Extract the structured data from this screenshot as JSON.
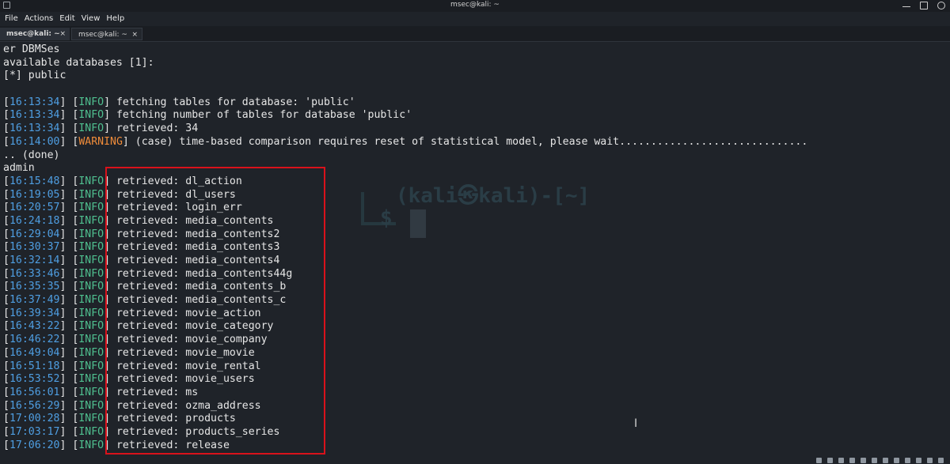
{
  "window": {
    "title": "msec@kali: ~"
  },
  "menu": [
    "File",
    "Actions",
    "Edit",
    "View",
    "Help"
  ],
  "tabs": [
    {
      "label": "msec@kali: ~",
      "active": true
    },
    {
      "label": "msec@kali: ~",
      "active": false
    }
  ],
  "icons": [
    "terminal-app-icon",
    "minimize-icon",
    "maximize-icon",
    "close-icon",
    "tab-close-icon",
    "text-cursor-icon"
  ],
  "colors": {
    "timestamp": "#4f9fe3",
    "info": "#4fbf8f",
    "warning": "#f08c3a",
    "highlight": "#d9121b",
    "background": "#1f2329"
  },
  "watermark": {
    "text": "(kali㉿kali)-[~]",
    "prompt": "$"
  },
  "header_lines": [
    "er DBMSes",
    "available databases [1]:",
    "[*] public",
    ""
  ],
  "pre_log": [
    {
      "ts": "16:13:34",
      "level": "INFO",
      "msg": "fetching tables for database: 'public'"
    },
    {
      "ts": "16:13:34",
      "level": "INFO",
      "msg": "fetching number of tables for database 'public'"
    },
    {
      "ts": "16:13:34",
      "level": "INFO",
      "msg": "retrieved: 34"
    },
    {
      "ts": "16:14:00",
      "level": "WARNING",
      "msg": "(case) time-based comparison requires reset of statistical model, please wait.............................."
    }
  ],
  "mid_lines": [
    ".. (done)",
    "admin"
  ],
  "retrieved_log": [
    {
      "ts": "16:15:48",
      "level": "INFO",
      "msg": "retrieved: dl_action"
    },
    {
      "ts": "16:19:05",
      "level": "INFO",
      "msg": "retrieved: dl_users"
    },
    {
      "ts": "16:20:57",
      "level": "INFO",
      "msg": "retrieved: login_err"
    },
    {
      "ts": "16:24:18",
      "level": "INFO",
      "msg": "retrieved: media_contents"
    },
    {
      "ts": "16:29:04",
      "level": "INFO",
      "msg": "retrieved: media_contents2"
    },
    {
      "ts": "16:30:37",
      "level": "INFO",
      "msg": "retrieved: media_contents3"
    },
    {
      "ts": "16:32:14",
      "level": "INFO",
      "msg": "retrieved: media_contents4"
    },
    {
      "ts": "16:33:46",
      "level": "INFO",
      "msg": "retrieved: media_contents44g"
    },
    {
      "ts": "16:35:35",
      "level": "INFO",
      "msg": "retrieved: media_contents_b"
    },
    {
      "ts": "16:37:49",
      "level": "INFO",
      "msg": "retrieved: media_contents_c"
    },
    {
      "ts": "16:39:34",
      "level": "INFO",
      "msg": "retrieved: movie_action"
    },
    {
      "ts": "16:43:22",
      "level": "INFO",
      "msg": "retrieved: movie_category"
    },
    {
      "ts": "16:46:22",
      "level": "INFO",
      "msg": "retrieved: movie_company"
    },
    {
      "ts": "16:49:04",
      "level": "INFO",
      "msg": "retrieved: movie_movie"
    },
    {
      "ts": "16:51:18",
      "level": "INFO",
      "msg": "retrieved: movie_rental"
    },
    {
      "ts": "16:53:52",
      "level": "INFO",
      "msg": "retrieved: movie_users"
    },
    {
      "ts": "16:56:01",
      "level": "INFO",
      "msg": "retrieved: ms"
    },
    {
      "ts": "16:56:29",
      "level": "INFO",
      "msg": "retrieved: ozma_address"
    },
    {
      "ts": "17:00:28",
      "level": "INFO",
      "msg": "retrieved: products"
    },
    {
      "ts": "17:03:17",
      "level": "INFO",
      "msg": "retrieved: products_series"
    },
    {
      "ts": "17:06:20",
      "level": "INFO",
      "msg": "retrieved: release"
    }
  ]
}
